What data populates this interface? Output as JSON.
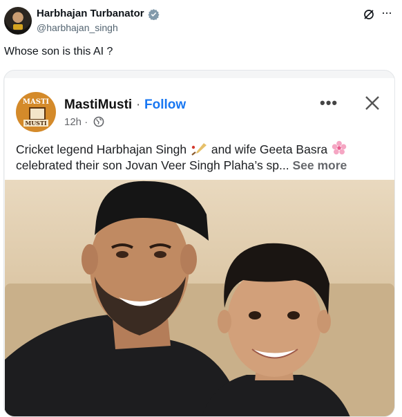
{
  "tweet": {
    "display_name": "Harbhajan Turbanator",
    "handle": "@harbhajan_singh",
    "text": "Whose son is this AI ?",
    "icons": {
      "verified": "verified-badge-icon",
      "grok": "grok-icon",
      "more": "more-options-icon"
    }
  },
  "embedded_post": {
    "page_logo": {
      "top_text": "MASTI",
      "bottom_text": "MUSTI"
    },
    "page_name": "MastiMusti",
    "separator": "·",
    "follow_label": "Follow",
    "time": "12h ·",
    "text_line1_a": "Cricket legend Harbhajan Singh",
    "text_line1_b": "and wife Geeta Basra",
    "text_line2": "celebrated their son Jovan Veer Singh Plaha’s sp...",
    "see_more_label": "See more",
    "options_label": "•••",
    "colors": {
      "follow": "#1877f2",
      "verified": "#829aab"
    }
  }
}
